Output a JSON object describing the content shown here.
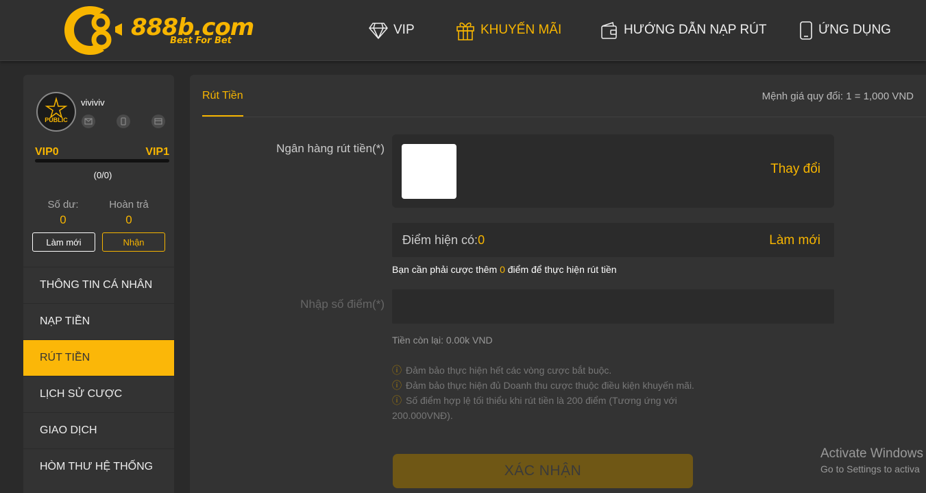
{
  "header": {
    "logo_text": "888b.com",
    "logo_tagline": "Best For Bet",
    "nav": [
      {
        "label": "VIP",
        "icon": "diamond-icon"
      },
      {
        "label": "KHUYẾN MÃI",
        "icon": "gift-icon"
      },
      {
        "label": "HƯỚNG DẪN NẠP RÚT",
        "icon": "wallet-icon"
      },
      {
        "label": "ỨNG DỤNG",
        "icon": "mobile-phone-icon"
      }
    ],
    "active_color": "#f7b500"
  },
  "sidebar": {
    "avatar_text": "PUBLIC",
    "username": "viviviv",
    "vip_current": "VIP0",
    "vip_next": "VIP1",
    "vip_progress_fraction": 0,
    "progress_text": "(0/0)",
    "balance_label": "Số dư:",
    "balance_value": "0",
    "rebate_label": "Hoàn trả",
    "rebate_value": "0",
    "refresh_button": "Làm mới",
    "claim_button": "Nhận",
    "menu": [
      {
        "label": "THÔNG TIN CÁ NHÂN"
      },
      {
        "label": "NẠP TIỀN"
      },
      {
        "label": "RÚT TIỀN"
      },
      {
        "label": "LỊCH SỬ CƯỢC"
      },
      {
        "label": "GIAO DỊCH"
      },
      {
        "label": "HÒM THƯ HỆ THỐNG"
      }
    ],
    "active_menu_color": "#fbb708"
  },
  "main": {
    "tab_label": "Rút Tiền",
    "exchange_rate": "Mệnh giá quy đổi: 1 = 1,000 VND",
    "bank_label": "Ngân hàng rút tiền(*)",
    "change_link": "Thay đổi",
    "points_label": "Điểm hiện có:",
    "points_value": "0",
    "points_refresh": "Làm mới",
    "bet_note_prefix": "Bạn cần phải cược thêm ",
    "bet_note_value": "0",
    "bet_note_suffix": " điểm để thực hiện rút tiền",
    "amount_label": "Nhập số điểm(*)",
    "amount_value": "",
    "remaining_text": "Tiền còn lại: 0.00k VND",
    "notes": [
      "Đảm bảo thực hiện hết các vòng cược bắt buộc.",
      "Đảm bảo thực hiện đủ Doanh thu cược thuộc điều kiện khuyến mãi.",
      "Số điểm hợp lệ tối thiểu khi rút tiền là 200 điểm (Tương ứng với 200.000VNĐ)."
    ],
    "warn_symbol": "ⓘ",
    "confirm_button": "XÁC NHẬN"
  },
  "watermark": {
    "line1": "Activate Windows",
    "line2": "Go to Settings to activa"
  }
}
